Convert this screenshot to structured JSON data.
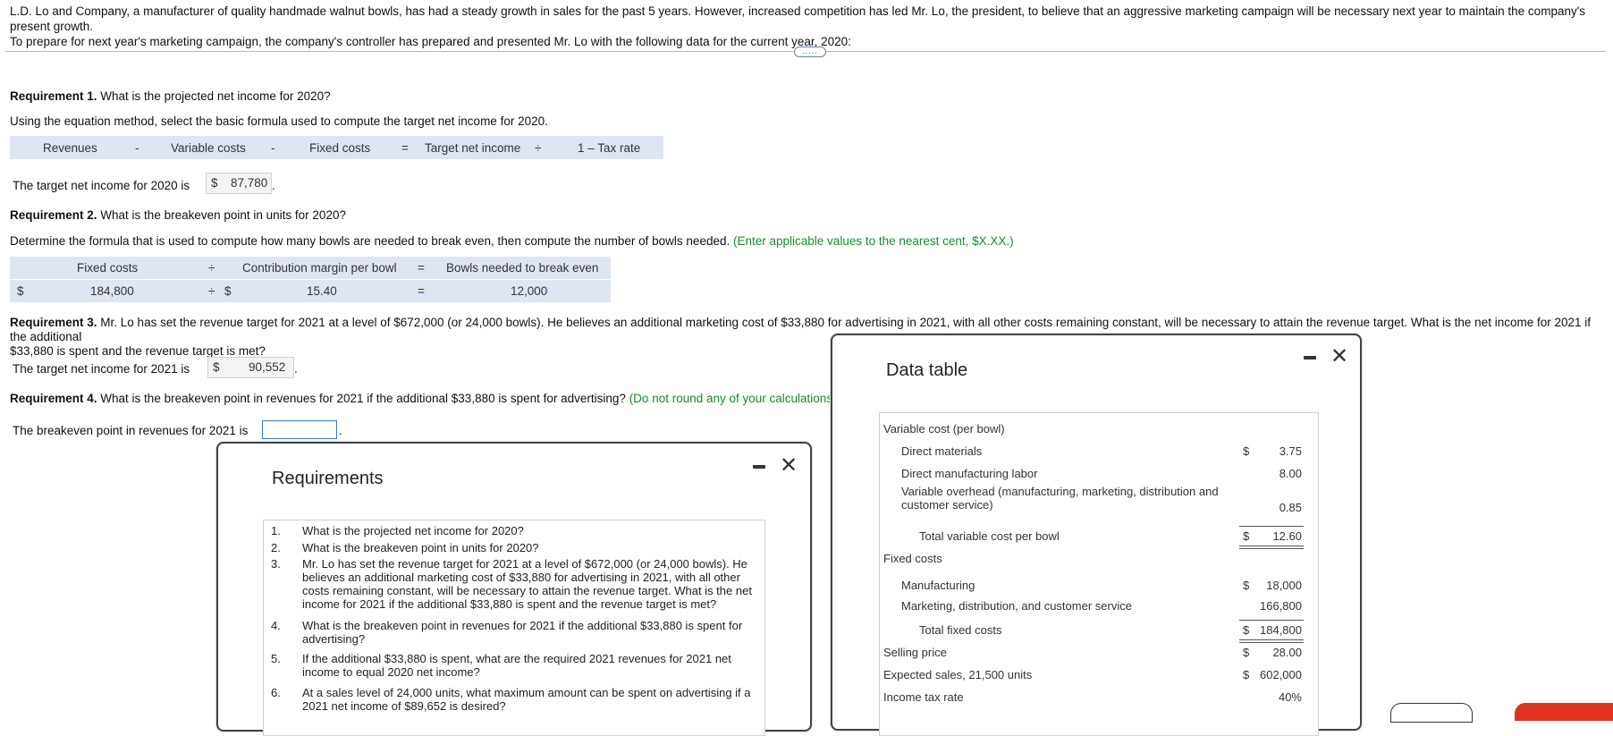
{
  "intro": {
    "line1": "L.D. Lo and Company, a manufacturer of quality handmade walnut bowls, has had a steady growth in sales for the past 5 years. However, increased competition has led Mr. Lo, the president, to believe that an aggressive marketing campaign will be necessary next year to maintain the company's present growth.",
    "line2": "To prepare for next year's marketing campaign, the company's controller has prepared and presented Mr. Lo with the following data for the current year, 2020:",
    "more": "....."
  },
  "req1": {
    "label": "Requirement 1.",
    "question": "What is the projected net income for 2020?",
    "instruction": "Using the equation method, select the basic formula used to compute the target net income for 2020.",
    "formula": {
      "t1": "Revenues",
      "op1": "-",
      "t2": "Variable costs",
      "op2": "-",
      "t3": "Fixed costs",
      "eq": "=",
      "t4": "Target net income",
      "op3": "÷",
      "t5": "1 – Tax rate"
    },
    "result_label": "The target net income for 2020 is",
    "result_currency": "$",
    "result_value": "87,780",
    "result_suffix": "."
  },
  "req2": {
    "label": "Requirement 2.",
    "question": "What is the breakeven point in units for 2020?",
    "instruction": "Determine the formula that is used to compute how many bowls are needed to break even, then compute the number of bowls needed.",
    "hint": "(Enter applicable values to the nearest cent, $X.XX.)",
    "headers": {
      "h1": "Fixed costs",
      "op1": "÷",
      "h2": "Contribution margin per bowl",
      "eq": "=",
      "h3": "Bowls needed to break even"
    },
    "values": {
      "cur1": "$",
      "v1": "184,800",
      "op1": "÷",
      "cur2": "$",
      "v2": "15.40",
      "eq": "=",
      "v3": "12,000"
    }
  },
  "req3": {
    "label": "Requirement 3.",
    "question_line1": "Mr. Lo has set the revenue target for 2021 at a level of $672,000 (or 24,000 bowls). He believes an additional marketing cost of $33,880 for advertising in 2021, with all other costs remaining constant, will be necessary to attain the revenue target. What is the net income for 2021 if the additional",
    "question_line2": "$33,880 is spent and the revenue target is met?",
    "result_label": "The target net income for 2021 is",
    "result_currency": "$",
    "result_value": "90,552",
    "result_suffix": "."
  },
  "req4": {
    "label": "Requirement 4.",
    "question": "What is the breakeven point in revenues for 2021 if the additional $33,880 is spent for advertising?",
    "hint": "(Do not round any of your calculations.)",
    "result_label": "The breakeven point in revenues for 2021 is",
    "result_value": "",
    "result_suffix": "."
  },
  "requirements_window": {
    "title": "Requirements",
    "items": [
      {
        "num": "1.",
        "text": "What is the projected net income for 2020?"
      },
      {
        "num": "2.",
        "text": "What is the breakeven point in units for 2020?"
      },
      {
        "num": "3.",
        "text": "Mr. Lo has set the revenue target for 2021 at a level of $672,000 (or 24,000 bowls). He believes an additional marketing cost of $33,880 for advertising in 2021, with all other costs remaining constant, will be necessary to attain the revenue target. What is the net income for 2021 if the additional $33,880 is spent and the revenue target is met?"
      },
      {
        "num": "4.",
        "text": "What is the breakeven point in revenues for 2021 if the additional $33,880 is spent for advertising?"
      },
      {
        "num": "5.",
        "text": "If the additional $33,880 is spent, what are the required 2021 revenues for 2021 net income to equal 2020 net income?"
      },
      {
        "num": "6.",
        "text": "At a sales level of 24,000 units, what maximum amount can be spent on advertising if a 2021 net income of $89,652 is desired?"
      }
    ]
  },
  "data_window": {
    "title": "Data table",
    "rows": [
      {
        "label": "Variable cost (per bowl)",
        "indent": 0,
        "cur": "",
        "value": ""
      },
      {
        "label": "Direct materials",
        "indent": 1,
        "cur": "$",
        "value": "3.75"
      },
      {
        "label": "Direct manufacturing labor",
        "indent": 1,
        "cur": "",
        "value": "8.00"
      },
      {
        "label": "Variable overhead (manufacturing, marketing, distribution and customer service)",
        "indent": 1,
        "cur": "",
        "value": "0.85"
      },
      {
        "label": "Total variable cost per bowl",
        "indent": 2,
        "cur": "$",
        "value": "12.60"
      },
      {
        "label": "Fixed costs",
        "indent": 0,
        "cur": "",
        "value": ""
      },
      {
        "label": "Manufacturing",
        "indent": 1,
        "cur": "$",
        "value": "18,000"
      },
      {
        "label": "Marketing, distribution, and customer service",
        "indent": 1,
        "cur": "",
        "value": "166,800"
      },
      {
        "label": "Total fixed costs",
        "indent": 2,
        "cur": "$",
        "value": "184,800"
      },
      {
        "label": "Selling price",
        "indent": 0,
        "cur": "$",
        "value": "28.00"
      },
      {
        "label": "Expected sales, 21,500 units",
        "indent": 0,
        "cur": "$",
        "value": "602,000"
      },
      {
        "label": "Income tax rate",
        "indent": 0,
        "cur": "",
        "value": "40%"
      }
    ]
  }
}
